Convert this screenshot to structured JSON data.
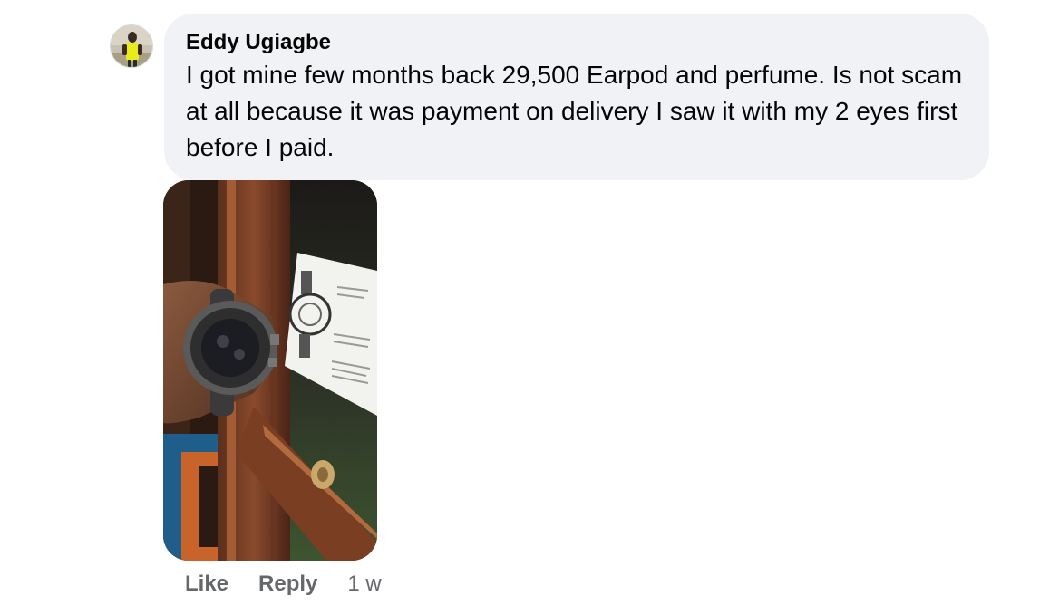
{
  "comment": {
    "author": "Eddy Ugiagbe",
    "text": "I got mine few months back 29,500 Earpod and perfume. Is not scam at all because it was payment on delivery I saw it with my 2 eyes first before I paid.",
    "avatar_icon": "user-avatar",
    "photo_icon": "wristwatch-photo"
  },
  "actions": {
    "like_label": "Like",
    "reply_label": "Reply",
    "timestamp": "1 w"
  },
  "colors": {
    "bubble_bg": "#f0f2f5",
    "secondary_text": "#65676b",
    "primary_text": "#050505"
  }
}
